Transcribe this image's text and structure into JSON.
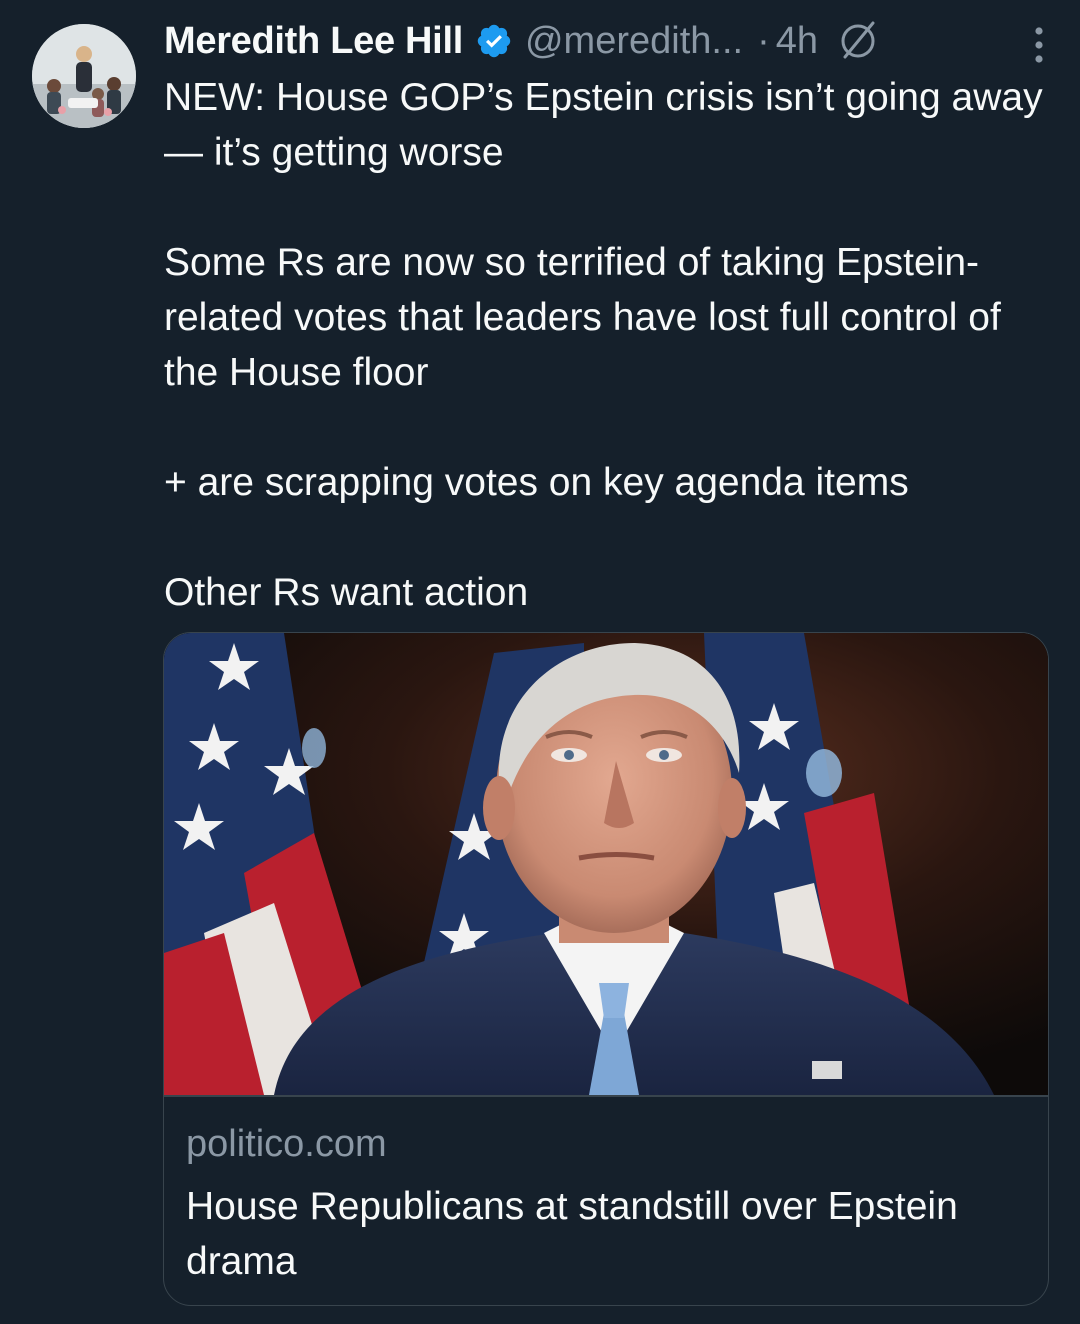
{
  "author": {
    "name": "Meredith Lee Hill",
    "handle": "@meredith...",
    "separator": "·",
    "time": "4h",
    "verified": true,
    "avatar_icon": "profile-photo"
  },
  "icons": {
    "verified": "verified-badge-icon",
    "grok": "grok-icon",
    "more": "more-vertical-icon"
  },
  "tweet": {
    "text": "NEW: House GOP’s Epstein crisis isn’t going away — it’s getting worse\n\nSome Rs are now so terrified of taking Epstein-related votes that leaders have lost full control of the House floor\n\n+ are scrapping votes on key agenda items\n\nOther Rs want action"
  },
  "link_card": {
    "domain": "politico.com",
    "title": "House Republicans at standstill over Epstein drama",
    "image_icon": "article-photo"
  },
  "colors": {
    "background": "#15202b",
    "text": "#f7f9f9",
    "secondary": "#8b98a5",
    "border": "#38444d",
    "verified": "#1d9bf0"
  }
}
